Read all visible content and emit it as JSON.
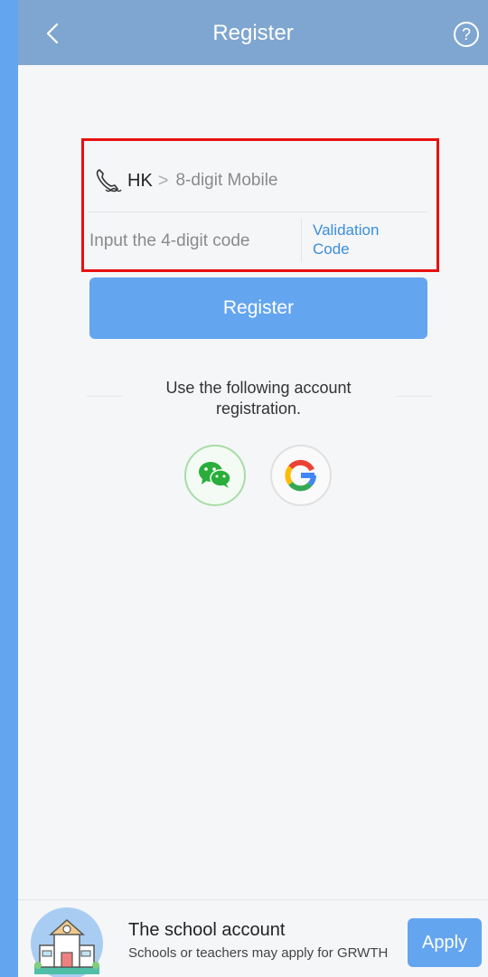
{
  "header": {
    "title": "Register",
    "back_icon": "chevron-left-icon",
    "help_icon": "help-circle-icon",
    "help_glyph": "?"
  },
  "form": {
    "phone_icon": "phone-icon",
    "country_code": "HK",
    "chevron": ">",
    "mobile_placeholder": "8-digit Mobile",
    "code_placeholder": "Input the 4-digit code",
    "validation_label_line1": "Validation",
    "validation_label_line2": "Code"
  },
  "register_button": "Register",
  "alternative": {
    "text_line1": "Use the following account",
    "text_line2": "registration.",
    "providers": [
      "wechat-icon",
      "google-icon"
    ]
  },
  "school": {
    "title": "The school account",
    "description": "Schools or teachers may apply for GRWTH",
    "apply_label": "Apply",
    "illustration": "school-building-icon"
  },
  "colors": {
    "header_bg": "#7fa6d0",
    "primary": "#64a5f0",
    "link": "#3a8edb",
    "highlight_border": "#e81010",
    "wechat_green": "#2aae3b"
  }
}
